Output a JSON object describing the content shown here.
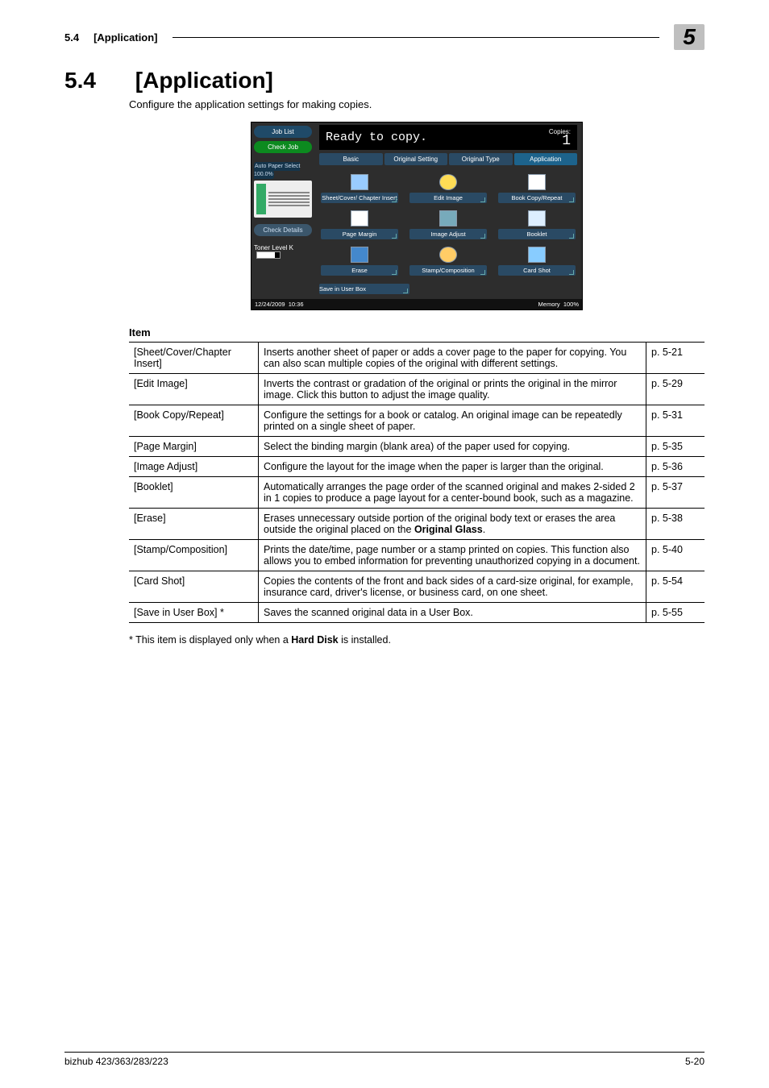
{
  "header": {
    "section_no": "5.4",
    "section_title": "[Application]",
    "chapter_badge": "5"
  },
  "title": {
    "number": "5.4",
    "text": "[Application]"
  },
  "intro": "Configure the application settings for making copies.",
  "panel": {
    "sidebar": {
      "job_list": "Job List",
      "check_job": "Check Job",
      "auto_paper": "Auto Paper Select  100.0%",
      "check_details": "Check Details",
      "toner_label": "Toner Level  K"
    },
    "ready_msg": "Ready to copy.",
    "copies_label": "Copies:",
    "copies_value": "1",
    "tabs": {
      "basic": "Basic",
      "orig_set": "Original Setting",
      "orig_type": "Original Type",
      "application": "Application"
    },
    "buttons": {
      "sheet": "Sheet/Cover/\nChapter Insert",
      "edit": "Edit Image",
      "book": "Book Copy/Repeat",
      "margin": "Page Margin",
      "adjust": "Image Adjust",
      "booklet": "Booklet",
      "erase": "Erase",
      "stamp": "Stamp/Composition",
      "card": "Card Shot",
      "save": "Save in User Box"
    },
    "footer": {
      "date": "12/24/2009",
      "time": "10:36",
      "mem_label": "Memory",
      "mem_value": "100%"
    }
  },
  "table_title": "Item",
  "rows": [
    {
      "item": "[Sheet/Cover/Chapter Insert]",
      "desc": "Inserts another sheet of paper or adds a cover page to the paper for copying. You can also scan multiple copies of the original with different settings.",
      "page": "p. 5-21"
    },
    {
      "item": "[Edit Image]",
      "desc": "Inverts the contrast or gradation of the original or prints the original in the mirror image. Click this button to adjust the image quality.",
      "page": "p. 5-29"
    },
    {
      "item": "[Book Copy/Repeat]",
      "desc": "Configure the settings for a book or catalog. An original image can be repeatedly printed on a single sheet of paper.",
      "page": "p. 5-31"
    },
    {
      "item": "[Page Margin]",
      "desc": "Select the binding margin (blank area) of the paper used for copying.",
      "page": "p. 5-35"
    },
    {
      "item": "[Image Adjust]",
      "desc": "Configure the layout for the image when the paper is larger than the original.",
      "page": "p. 5-36"
    },
    {
      "item": "[Booklet]",
      "desc": "Automatically arranges the page order of the scanned original and makes 2-sided 2 in 1 copies to produce a page layout for a center-bound book, such as a magazine.",
      "page": "p. 5-37"
    },
    {
      "item": "[Erase]",
      "desc_pre": "Erases unnecessary outside portion of the original body text or erases the area outside the original placed on the ",
      "desc_bold": "Original Glass",
      "desc_post": ".",
      "page": "p. 5-38"
    },
    {
      "item": "[Stamp/Composition]",
      "desc": "Prints the date/time, page number or a stamp printed on copies. This function also allows you to embed information for preventing unauthorized copying in a document.",
      "page": "p. 5-40"
    },
    {
      "item": "[Card Shot]",
      "desc": "Copies the contents of the front and back sides of a card-size original, for example, insurance card, driver's license, or business card, on one sheet.",
      "page": "p. 5-54"
    },
    {
      "item": "[Save in User Box] *",
      "desc": "Saves the scanned original data in a User Box.",
      "page": "p. 5-55"
    }
  ],
  "note_pre": "* This item is displayed only when a ",
  "note_bold": "Hard Disk",
  "note_post": " is installed.",
  "footer": {
    "left": "bizhub 423/363/283/223",
    "right": "5-20"
  }
}
